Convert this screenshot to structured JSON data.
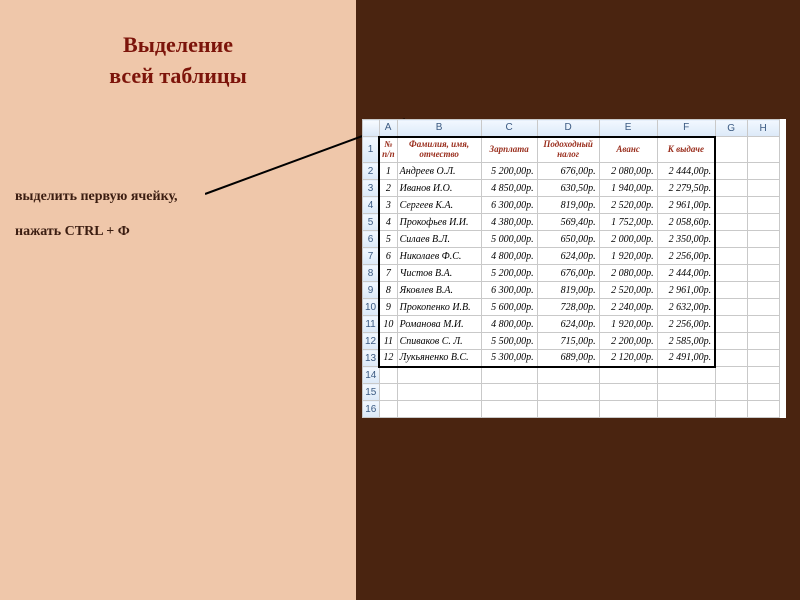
{
  "title_line1": "Выделение",
  "title_line2": "всей таблицы",
  "instr1": "выделить первую ячейку,",
  "instr2": "нажать CTRL + Ф",
  "columns": [
    "A",
    "B",
    "C",
    "D",
    "E",
    "F",
    "G",
    "H"
  ],
  "row_headers": [
    "1",
    "2",
    "3",
    "4",
    "5",
    "6",
    "7",
    "8",
    "9",
    "10",
    "11",
    "12",
    "13",
    "14",
    "15",
    "16"
  ],
  "table_header": {
    "A": "№ п/п",
    "B": "Фамилия, имя, отчество",
    "C": "Зарплата",
    "D": "Подоходный налог",
    "E": "Аванс",
    "F": "К выдаче"
  },
  "rows": [
    {
      "n": "1",
      "name": "Андреев О.Л.",
      "c": "5 200,00р.",
      "d": "676,00р.",
      "e": "2 080,00р.",
      "f": "2 444,00р."
    },
    {
      "n": "2",
      "name": "Иванов И.О.",
      "c": "4 850,00р.",
      "d": "630,50р.",
      "e": "1 940,00р.",
      "f": "2 279,50р."
    },
    {
      "n": "3",
      "name": "Сергеев К.А.",
      "c": "6 300,00р.",
      "d": "819,00р.",
      "e": "2 520,00р.",
      "f": "2 961,00р."
    },
    {
      "n": "4",
      "name": "Прокофьев И.И.",
      "c": "4 380,00р.",
      "d": "569,40р.",
      "e": "1 752,00р.",
      "f": "2 058,60р."
    },
    {
      "n": "5",
      "name": "Силаев В.Л.",
      "c": "5 000,00р.",
      "d": "650,00р.",
      "e": "2 000,00р.",
      "f": "2 350,00р."
    },
    {
      "n": "6",
      "name": "Николаев Ф.С.",
      "c": "4 800,00р.",
      "d": "624,00р.",
      "e": "1 920,00р.",
      "f": "2 256,00р."
    },
    {
      "n": "7",
      "name": "Чистов В.А.",
      "c": "5 200,00р.",
      "d": "676,00р.",
      "e": "2 080,00р.",
      "f": "2 444,00р."
    },
    {
      "n": "8",
      "name": "Яковлев В.А.",
      "c": "6 300,00р.",
      "d": "819,00р.",
      "e": "2 520,00р.",
      "f": "2 961,00р."
    },
    {
      "n": "9",
      "name": "Прокопенко И.В.",
      "c": "5 600,00р.",
      "d": "728,00р.",
      "e": "2 240,00р.",
      "f": "2 632,00р."
    },
    {
      "n": "10",
      "name": "Романова М.И.",
      "c": "4 800,00р.",
      "d": "624,00р.",
      "e": "1 920,00р.",
      "f": "2 256,00р."
    },
    {
      "n": "11",
      "name": "Спиваков С. Л.",
      "c": "5 500,00р.",
      "d": "715,00р.",
      "e": "2 200,00р.",
      "f": "2 585,00р."
    },
    {
      "n": "12",
      "name": "Лукьяненко В.С.",
      "c": "5 300,00р.",
      "d": "689,00р.",
      "e": "2 120,00р.",
      "f": "2 491,00р."
    }
  ]
}
